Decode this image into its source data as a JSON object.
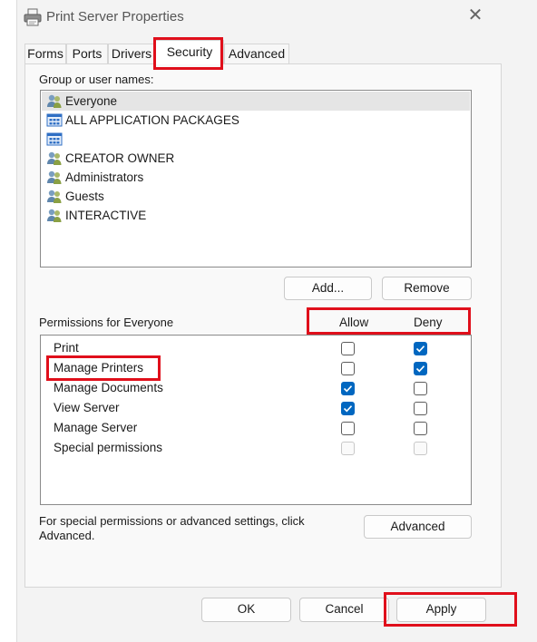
{
  "window": {
    "title": "Print Server Properties",
    "close_glyph": "✕",
    "icon": "printer-icon"
  },
  "tabs": [
    {
      "label": "Forms",
      "active": false
    },
    {
      "label": "Ports",
      "active": false
    },
    {
      "label": "Drivers",
      "active": false
    },
    {
      "label": "Security",
      "active": true
    },
    {
      "label": "Advanced",
      "active": false
    }
  ],
  "security": {
    "group_label": "Group or user names:",
    "users": [
      {
        "name": "Everyone",
        "icon": "user-group-icon",
        "selected": true
      },
      {
        "name": "ALL APPLICATION PACKAGES",
        "icon": "app-packages-icon",
        "selected": false
      },
      {
        "name": "",
        "icon": "app-packages-icon",
        "selected": false
      },
      {
        "name": "CREATOR OWNER",
        "icon": "user-group-icon",
        "selected": false
      },
      {
        "name": "Administrators",
        "icon": "user-group-icon",
        "selected": false
      },
      {
        "name": "Guests",
        "icon": "user-group-icon",
        "selected": false
      },
      {
        "name": "INTERACTIVE",
        "icon": "user-group-icon",
        "selected": false
      }
    ],
    "add_label": "Add...",
    "remove_label": "Remove",
    "permissions_label": "Permissions for Everyone",
    "allow_header": "Allow",
    "deny_header": "Deny",
    "permissions": [
      {
        "name": "Print",
        "allow": false,
        "deny": true,
        "disabled": false
      },
      {
        "name": "Manage Printers",
        "allow": false,
        "deny": true,
        "disabled": false
      },
      {
        "name": "Manage Documents",
        "allow": true,
        "deny": false,
        "disabled": false
      },
      {
        "name": "View Server",
        "allow": true,
        "deny": false,
        "disabled": false
      },
      {
        "name": "Manage Server",
        "allow": false,
        "deny": false,
        "disabled": false
      },
      {
        "name": "Special permissions",
        "allow": false,
        "deny": false,
        "disabled": true
      }
    ],
    "special_note": "For special permissions or advanced settings, click Advanced.",
    "advanced_label": "Advanced"
  },
  "footer": {
    "ok_label": "OK",
    "cancel_label": "Cancel",
    "apply_label": "Apply"
  },
  "colors": {
    "checkbox_checked": "#0067c0",
    "highlight": "#e00f1b"
  }
}
